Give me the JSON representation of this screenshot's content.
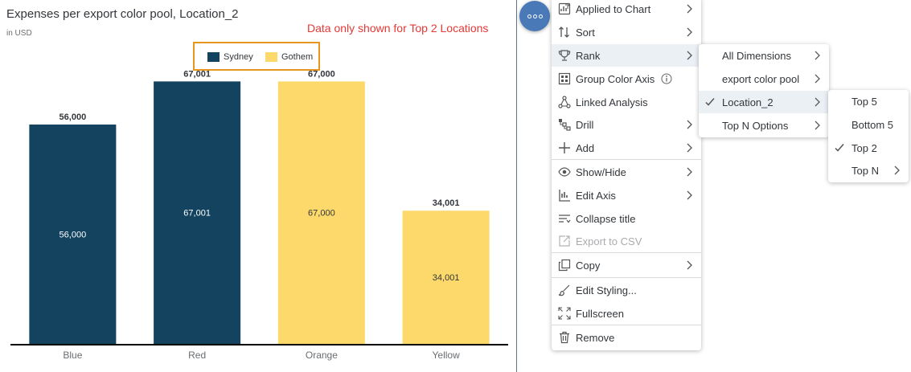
{
  "header": {
    "title": "Expenses per export color pool, Location_2",
    "subtitle": "in USD",
    "note": "Data only shown for Top 2 Locations"
  },
  "legend": [
    {
      "label": "Sydney",
      "color": "#13435f"
    },
    {
      "label": "Gothem",
      "color": "#fcd96a"
    }
  ],
  "chart_data": {
    "type": "bar",
    "title": "Expenses per export color pool, Location_2",
    "subtitle": "in USD",
    "categories": [
      "Blue",
      "Red",
      "Orange",
      "Yellow"
    ],
    "series": [
      {
        "name": "Sydney",
        "color": "#13435f",
        "values": [
          56000,
          67001,
          null,
          null
        ]
      },
      {
        "name": "Gothem",
        "color": "#fcd96a",
        "values": [
          null,
          null,
          67000,
          34001
        ]
      }
    ],
    "values": [
      56000,
      67001,
      67000,
      34001
    ],
    "top_labels": [
      "56,000",
      "67,001",
      "67,000",
      "34,001"
    ],
    "inner_labels": [
      "56,000",
      "67,001",
      "67,000",
      "34,001"
    ],
    "ylim": [
      0,
      80000
    ],
    "grid": false,
    "legend_position": "top-center",
    "xlabel": "",
    "ylabel": ""
  },
  "menu": {
    "items": [
      {
        "label": "Applied to Chart",
        "icon": "chart-filter-icon",
        "submenu": true
      },
      {
        "label": "Sort",
        "icon": "sort-icon",
        "submenu": true
      },
      {
        "label": "Rank",
        "icon": "trophy-icon",
        "submenu": true,
        "selected": true
      },
      {
        "label": "Group Color Axis",
        "icon": "group-axis-icon",
        "info": true
      },
      {
        "label": "Linked Analysis",
        "icon": "linked-analysis-icon"
      },
      {
        "label": "Drill",
        "icon": "drill-icon",
        "submenu": true
      },
      {
        "label": "Add",
        "icon": "plus-icon",
        "submenu": true
      },
      {
        "label": "Show/Hide",
        "icon": "eye-icon",
        "submenu": true
      },
      {
        "label": "Edit Axis",
        "icon": "edit-axis-icon",
        "submenu": true
      },
      {
        "label": "Collapse title",
        "icon": "collapse-title-icon"
      },
      {
        "label": "Export to CSV",
        "icon": "export-icon",
        "disabled": true
      },
      {
        "label": "Copy",
        "icon": "copy-icon",
        "submenu": true
      },
      {
        "label": "Edit Styling...",
        "icon": "brush-icon"
      },
      {
        "label": "Fullscreen",
        "icon": "fullscreen-icon"
      },
      {
        "label": "Remove",
        "icon": "trash-icon"
      }
    ],
    "rank_submenu": [
      {
        "label": "All Dimensions",
        "submenu": true
      },
      {
        "label": "export color pool",
        "submenu": true
      },
      {
        "label": "Location_2",
        "submenu": true,
        "checked": true,
        "selected": true
      },
      {
        "label": "Top N Options",
        "submenu": true
      }
    ],
    "location_submenu": [
      {
        "label": "Top 5"
      },
      {
        "label": "Bottom 5"
      },
      {
        "label": "Top 2",
        "checked": true
      },
      {
        "label": "Top N",
        "submenu": true
      }
    ]
  }
}
